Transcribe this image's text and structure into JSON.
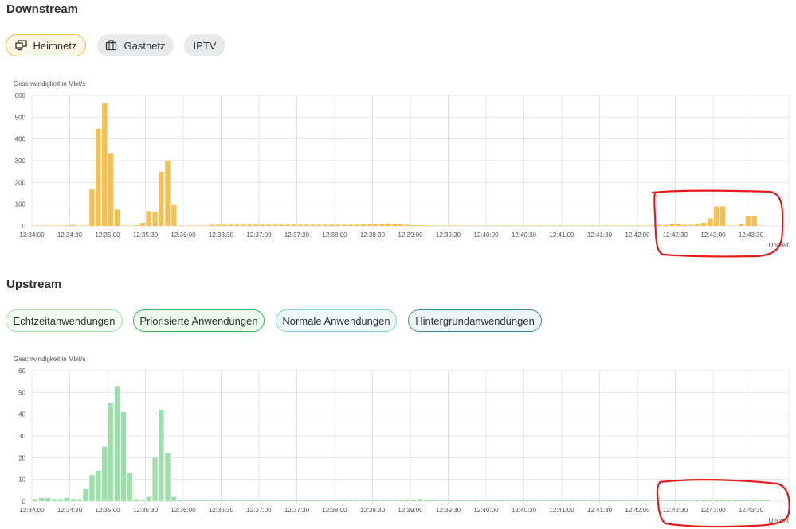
{
  "downstream": {
    "title": "Downstream",
    "tabs": [
      {
        "label": "Heimnetz",
        "icon": "monitors-icon",
        "active": true
      },
      {
        "label": "Gastnetz",
        "icon": "suitcase-icon",
        "active": false
      },
      {
        "label": "IPTV",
        "icon": "",
        "active": false
      }
    ]
  },
  "upstream": {
    "title": "Upstream",
    "tabs": [
      {
        "label": "Echtzeitanwendungen",
        "border": "#9ee0a6",
        "bg": "#f3fbf4"
      },
      {
        "label": "Priorisierte Anwendungen",
        "border": "#3fb355",
        "bg": "#ecf7ee"
      },
      {
        "label": "Normale Anwendungen",
        "border": "#7fcfd0",
        "bg": "#eff9f9"
      },
      {
        "label": "Hintergrundanwendungen",
        "border": "#3a8c8a",
        "bg": "#ecf4f4"
      }
    ]
  },
  "colors": {
    "downstream_bar": "#f5c04f",
    "upstream_bar": "#9ae0a8",
    "annotation": "#e31b1b",
    "grid": "#e4e4e4"
  },
  "chart_data": [
    {
      "type": "bar",
      "title": "",
      "ylabel": "Geschwindigkeit in Mbit/s",
      "xlabel": "Uhrzeit",
      "ylim": [
        0,
        600
      ],
      "yticks": [
        0,
        100,
        200,
        300,
        400,
        500,
        600
      ],
      "x_start": "12:34:00",
      "x_end": "12:44:00",
      "bar_interval_seconds": 5,
      "xticks": [
        "12:34:00",
        "12:34:30",
        "12:35:00",
        "12:35:30",
        "12:36:00",
        "12:36:30",
        "12:37:00",
        "12:37:30",
        "12:38:00",
        "12:38:30",
        "12:39:00",
        "12:39:30",
        "12:40:00",
        "12:40:30",
        "12:41:00",
        "12:41:30",
        "12:42:00",
        "12:42:30",
        "12:43:00",
        "12:43:30"
      ],
      "values": [
        1,
        1,
        1,
        1,
        1,
        2,
        5,
        2,
        1,
        168,
        447,
        565,
        335,
        75,
        2,
        1,
        3,
        15,
        68,
        65,
        250,
        300,
        95,
        2,
        1,
        1,
        1,
        1,
        5,
        6,
        6,
        6,
        6,
        6,
        6,
        6,
        6,
        6,
        6,
        6,
        6,
        6,
        6,
        6,
        6,
        6,
        6,
        6,
        6,
        6,
        6,
        6,
        7,
        7,
        8,
        10,
        12,
        10,
        8,
        6,
        4,
        3,
        3,
        2,
        2,
        2,
        2,
        2,
        2,
        2,
        2,
        2,
        2,
        2,
        2,
        2,
        2,
        2,
        2,
        2,
        2,
        2,
        2,
        2,
        2,
        2,
        2,
        2,
        2,
        2,
        2,
        2,
        2,
        2,
        2,
        2,
        2,
        2,
        3,
        5,
        5,
        10,
        10,
        5,
        5,
        8,
        15,
        35,
        90,
        90,
        2,
        1,
        10,
        45,
        45,
        1
      ],
      "grid": true
    },
    {
      "type": "bar",
      "title": "",
      "ylabel": "Geschwindigkeit in Mbit/s",
      "xlabel": "Uhrzeit",
      "ylim": [
        0,
        60
      ],
      "yticks": [
        0,
        10,
        20,
        30,
        40,
        50,
        60
      ],
      "x_start": "12:34:00",
      "x_end": "12:44:00",
      "bar_interval_seconds": 5,
      "xticks": [
        "12:34:00",
        "12:34:30",
        "12:35:00",
        "12:35:30",
        "12:36:00",
        "12:36:30",
        "12:37:00",
        "12:37:30",
        "12:38:00",
        "12:38:30",
        "12:39:00",
        "12:39:30",
        "12:40:00",
        "12:40:30",
        "12:41:00",
        "12:41:30",
        "12:42:00",
        "12:42:30",
        "12:43:00",
        "12:43:30"
      ],
      "values": [
        1,
        1.5,
        1.5,
        1,
        1,
        1.5,
        1,
        1,
        5.5,
        12,
        14,
        25,
        45,
        53,
        41,
        13,
        1,
        0.5,
        2,
        20,
        42,
        22,
        2,
        0.5,
        0.3,
        0.3,
        0.3,
        0.3,
        0.3,
        0.3,
        0.3,
        0.3,
        0.3,
        0.3,
        0.3,
        0.3,
        0.3,
        0.3,
        0.3,
        0.3,
        0.3,
        0.3,
        0.3,
        0.3,
        0.3,
        0.3,
        0.3,
        0.3,
        0.3,
        0.3,
        0.3,
        0.3,
        0.3,
        0.3,
        0.3,
        0.3,
        0.3,
        0.3,
        0.3,
        0.5,
        0.8,
        1,
        0.5,
        0.5,
        0.3,
        0.3,
        0.3,
        0.3,
        0.3,
        0.3,
        0.3,
        0.3,
        0.3,
        0.3,
        0.3,
        0.3,
        0.3,
        0.3,
        0.3,
        0.3,
        0.3,
        0.3,
        0.3,
        0.3,
        0.3,
        0.3,
        0.3,
        0.3,
        0.3,
        0.3,
        0.3,
        0.3,
        0.3,
        0.3,
        0.3,
        0.3,
        0.3,
        0.3,
        0.3,
        0.3,
        0.3,
        0.3,
        0.3,
        0.3,
        0.3,
        0.5,
        0.5,
        0.5,
        0.5,
        0.5,
        0.5,
        0.5,
        0.3,
        0.3,
        0.5,
        0.5,
        0.5
      ],
      "grid": true
    }
  ]
}
